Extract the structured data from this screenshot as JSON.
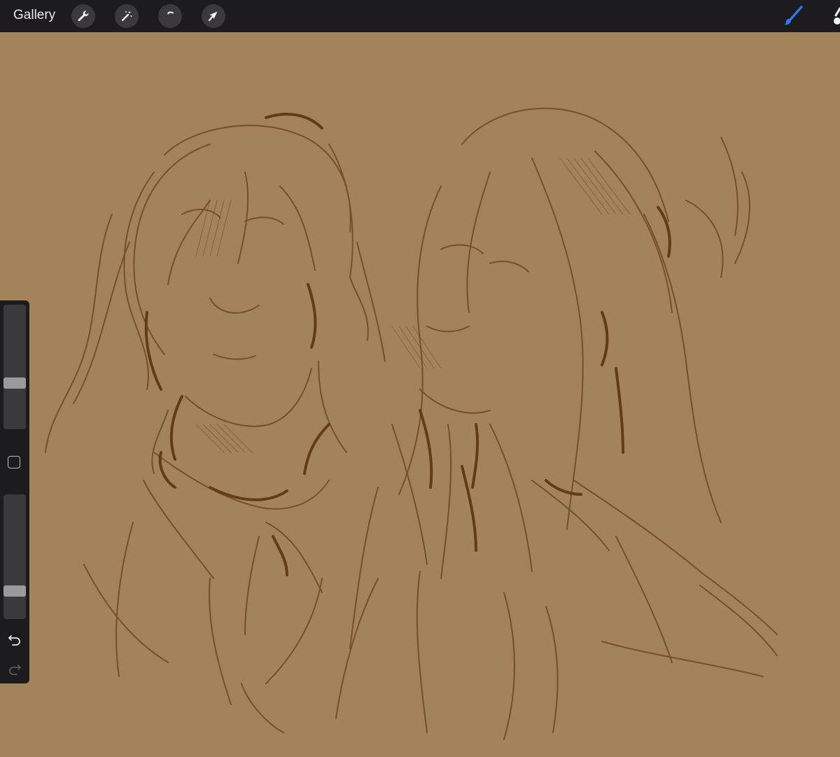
{
  "toolbar": {
    "gallery_label": "Gallery",
    "tools": [
      {
        "name": "actions",
        "icon": "wrench-icon"
      },
      {
        "name": "adjustments",
        "icon": "magic-wand-icon"
      },
      {
        "name": "selection",
        "icon": "selection-s-icon"
      },
      {
        "name": "transform",
        "icon": "arrow-cursor-icon"
      }
    ],
    "brush": {
      "icon": "brush-icon",
      "color": "#2f7bf5"
    }
  },
  "canvas": {
    "background_color": "#a3835a",
    "stroke_color": "#6b4a22",
    "content": "sketch"
  },
  "sidebar": {
    "brush_size": 0.36,
    "brush_opacity": 0.2,
    "modifier_icon": "square-modifier-icon",
    "undo_icon": "undo-icon",
    "redo_icon": "redo-icon",
    "redo_enabled": false
  },
  "colors": {
    "bar": "#1c1c1e",
    "button": "#3a3a3c",
    "accent": "#2f7bf5"
  }
}
